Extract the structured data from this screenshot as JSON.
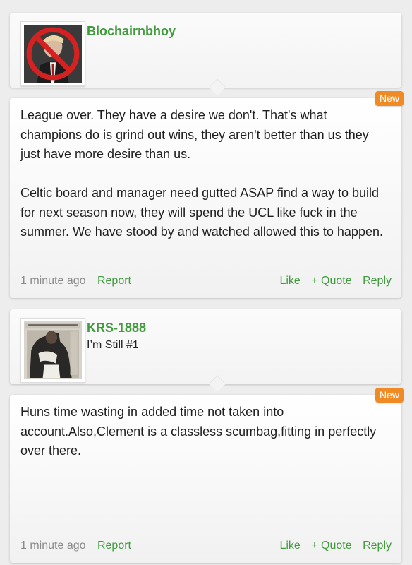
{
  "posts": [
    {
      "username": "Blochairnbhoy",
      "user_title": "",
      "avatar_icon": "no-trump-icon",
      "badge": "New",
      "message": "League over. They have a desire we don't. That's what champions do is grind out wins, they aren't better than us they just have more desire than us.\n\nCeltic board and manager need gutted ASAP find a way to build for next season now, they will spend the UCL like fuck in the summer. We have stood by and watched allowed this to happen.",
      "time": "1 minute ago",
      "report": "Report",
      "like": "Like",
      "quote": "+ Quote",
      "reply": "Reply"
    },
    {
      "username": "KRS-1888",
      "user_title": "I’m Still #1",
      "avatar_icon": "album-cover-photo",
      "badge": "New",
      "message": "Huns time wasting in added time not taken into account.Also,Clement is a classless scumbag,fitting in perfectly over there.",
      "time": "1 minute ago",
      "report": "Report",
      "like": "Like",
      "quote": "+ Quote",
      "reply": "Reply"
    }
  ],
  "colors": {
    "accent_green": "#3f9b3c",
    "badge_orange": "#f08a24",
    "timestamp_gray": "#8a8a8a",
    "background": "#ededed"
  }
}
